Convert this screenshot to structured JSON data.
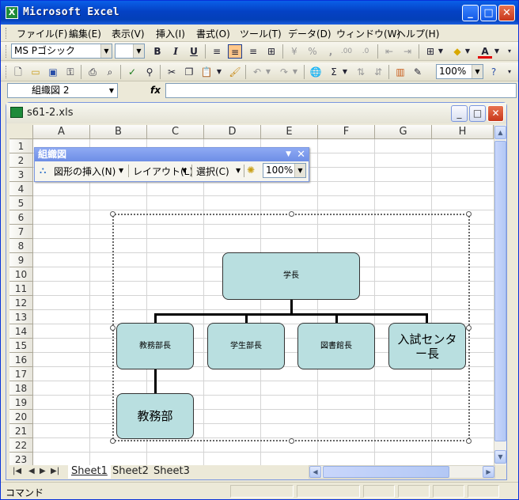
{
  "app": {
    "title": "Microsoft Excel",
    "icon": "X"
  },
  "menu": [
    "ファイル(F)",
    "編集(E)",
    "表示(V)",
    "挿入(I)",
    "書式(O)",
    "ツール(T)",
    "データ(D)",
    "ウィンドウ(W)",
    "ヘルプ(H)"
  ],
  "format_toolbar": {
    "font": "MS Pゴシック",
    "size": "",
    "bold": "B",
    "italic": "I",
    "underline": "U",
    "percent": "%",
    "comma": ",",
    "inc_decimal": ".00",
    "dec_decimal": ".0",
    "font_color": "A"
  },
  "standard_toolbar": {
    "zoom": "100%",
    "sigma": "Σ"
  },
  "formula_bar": {
    "name_box": "組織図 2",
    "fx": "fx",
    "value": ""
  },
  "document": {
    "title": "s61-2.xls"
  },
  "columns": [
    "A",
    "B",
    "C",
    "D",
    "E",
    "F",
    "G",
    "H"
  ],
  "rows": [
    "1",
    "2",
    "3",
    "4",
    "5",
    "6",
    "7",
    "8",
    "9",
    "10",
    "11",
    "12",
    "13",
    "14",
    "15",
    "16",
    "17",
    "18",
    "19",
    "20",
    "21",
    "22",
    "23"
  ],
  "org_toolbar": {
    "title": "組織図",
    "insert_shape": "図形の挿入(N)",
    "layout": "レイアウト(L)",
    "select": "選択(C)",
    "zoom": "100%"
  },
  "org_chart": {
    "top": "学長",
    "children": [
      "教務部長",
      "学生部長",
      "図書館長",
      "入試センター長"
    ],
    "grandchild": "教務部"
  },
  "sheets": [
    "Sheet1",
    "Sheet2",
    "Sheet3"
  ],
  "status": "コマンド"
}
